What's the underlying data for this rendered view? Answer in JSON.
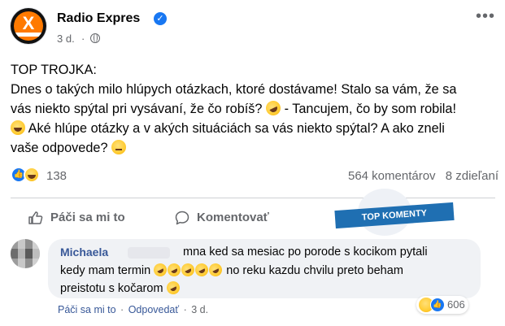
{
  "post": {
    "page_name": "Radio Expres",
    "time": "3 d.",
    "dot": "·",
    "more": "•••",
    "text_lines": [
      "TOP TROJKA:",
      "Dnes o takých milo hlúpych otázkach, ktoré dostávame! Stalo sa vám, že sa",
      "vás niekto spýtal pri vysávaní, že čo robíš?",
      "- Tancujem, čo by som robila!",
      "Aké hlúpe otázky a v akých situáciách sa vás niekto spýtal? A ako zneli",
      "vaše odpovede?"
    ]
  },
  "reactions": {
    "count": "138",
    "comments": "564 komentárov",
    "shares": "8 zdieľaní"
  },
  "actions": {
    "like_label": "Páči sa mi to",
    "comment_label": "Komentovať"
  },
  "badge": {
    "label": "TOP KOMENTY"
  },
  "comment": {
    "author": "Michaela",
    "line1": "mna ked sa mesiac po porode s kocikom pytali",
    "line2_a": "kedy mam termin",
    "line2_b": "no reku kazdu chvilu preto beham",
    "line3": "preistotu s kočarom",
    "reaction_count": "606",
    "like_label": "Páči sa mi to",
    "reply_label": "Odpovedať",
    "time": "3 d.",
    "dot": "·"
  },
  "colors": {
    "brand_blue": "#1877f2",
    "link_blue": "#385898",
    "muted": "#65676b",
    "bubble_bg": "#f0f2f5",
    "badge_ribbon": "#1f6fb2"
  }
}
